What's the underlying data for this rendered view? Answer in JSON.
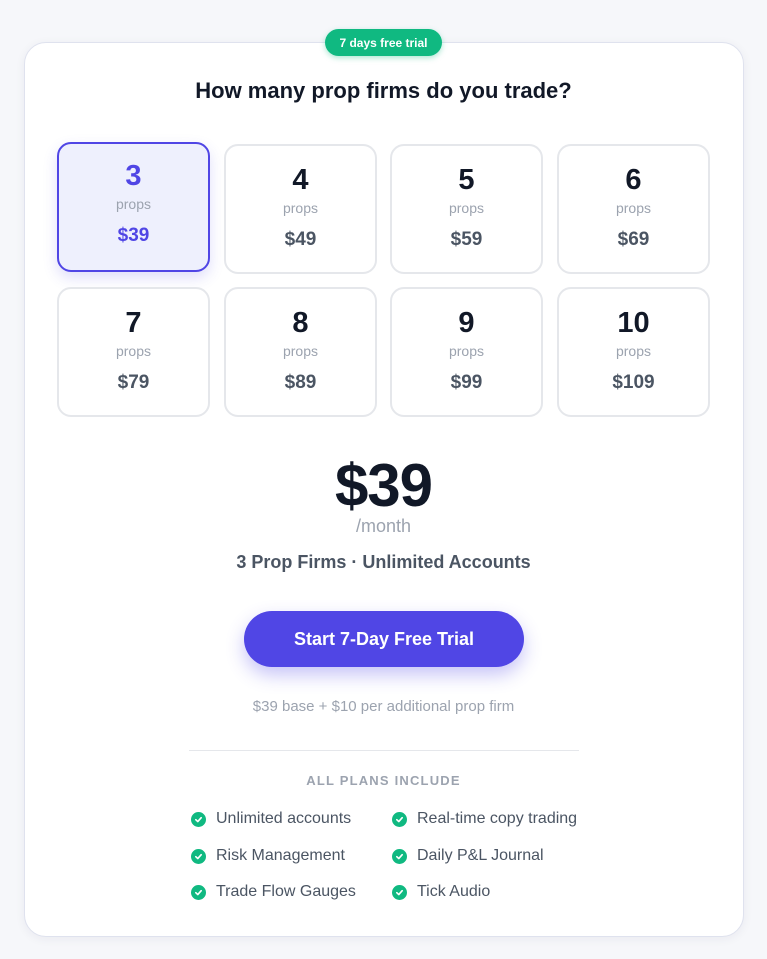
{
  "badge": {
    "label": "7 days free trial"
  },
  "question": "How many prop firms do you trade?",
  "unit_label": "props",
  "tiles": [
    {
      "count": "3",
      "price": "$39",
      "selected": true
    },
    {
      "count": "4",
      "price": "$49",
      "selected": false
    },
    {
      "count": "5",
      "price": "$59",
      "selected": false
    },
    {
      "count": "6",
      "price": "$69",
      "selected": false
    },
    {
      "count": "7",
      "price": "$79",
      "selected": false
    },
    {
      "count": "8",
      "price": "$89",
      "selected": false
    },
    {
      "count": "9",
      "price": "$99",
      "selected": false
    },
    {
      "count": "10",
      "price": "$109",
      "selected": false
    }
  ],
  "selected_plan": {
    "price": "$39",
    "period": "/month",
    "summary": "3 Prop Firms · Unlimited Accounts"
  },
  "cta": {
    "label": "Start 7-Day Free Trial"
  },
  "pricing_note": "$39 base + $10 per additional prop firm",
  "includes": {
    "title": "ALL PLANS INCLUDE",
    "features_left": [
      "Unlimited accounts",
      "Risk Management",
      "Trade Flow Gauges"
    ],
    "features_right": [
      "Real-time copy trading",
      "Daily P&L Journal",
      "Tick Audio"
    ]
  },
  "colors": {
    "accent": "#5046e5",
    "success": "#10b981",
    "selected_bg": "#eef0fd"
  },
  "icons": {
    "feature_check": "check-circle-icon"
  }
}
